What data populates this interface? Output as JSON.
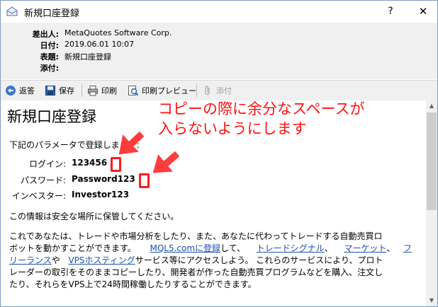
{
  "window": {
    "title": "新規口座登録",
    "help": "?",
    "close": "✕"
  },
  "header": {
    "from_label": "差出人:",
    "from_value": "MetaQuotes Software Corp.",
    "date_label": "日付:",
    "date_value": "2019.06.01 10:07",
    "subject_label": "表題:",
    "subject_value": "新規口座登録",
    "attach_label": "添付:",
    "attach_value": ""
  },
  "toolbar": {
    "reply": "返答",
    "save": "保存",
    "print": "印刷",
    "print_preview": "印刷プレビュー",
    "attach": "添付"
  },
  "body": {
    "title": "新規口座登録",
    "intro": "下記のパラメータで登録しました:",
    "login_label": "ログイン:",
    "login_value": "123456",
    "password_label": "パスワード:",
    "password_value": "Password123",
    "investor_label": "インベスター:",
    "investor_value": "Investor123",
    "safe_note": "この情報は安全な場所に保管してください。",
    "para_line1": "これであなたは、トレードや市場分析をしたり、また、あなたに代わってトレードする自動売買ロ",
    "para_line2_a": "ボットを動かすことができます。",
    "link_mql5": "MQL5.comに登録",
    "para_line2_b": "して、",
    "link_signals": "トレードシグナル",
    "para_comma1": "、",
    "link_market": "マーケット",
    "para_comma2": "、",
    "link_freelance_a": "フ",
    "link_freelance_b": "リーランス",
    "para_ya": "や",
    "link_vps": "VPSホスティング",
    "para_line3_rest": "サービス等にアクセスしよう。 これらのサービスにより、プロト",
    "para_line4": "レーダーの取引をそのままコピーしたり、開発者が作った自動売買プログラムなどを購入、注文し",
    "para_line5": "たり、それらをVPS上で24時間稼働したりすることができます。"
  },
  "annotation": {
    "line1": "コピーの際に余分なスペースが",
    "line2": "入らないようにします",
    "color": "#ff1a1a"
  },
  "scrollbar": {
    "up": "▲",
    "down": "▼"
  }
}
